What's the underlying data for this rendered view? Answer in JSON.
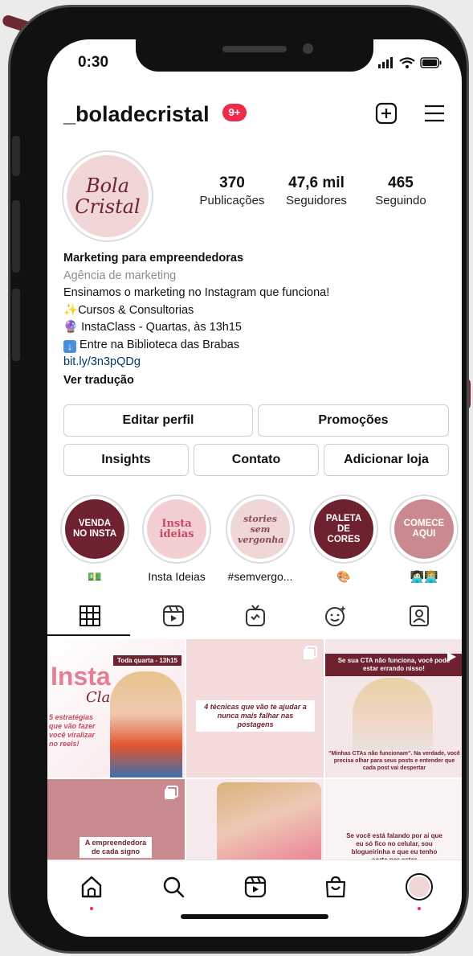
{
  "status": {
    "time": "0:30"
  },
  "profile": {
    "username": "_boladecristal",
    "notifications": "9+",
    "avatar_text_1": "Bola",
    "avatar_text_2": "Cristal",
    "stats": [
      {
        "value": "370",
        "label": "Publicações"
      },
      {
        "value": "47,6 mil",
        "label": "Seguidores"
      },
      {
        "value": "465",
        "label": "Seguindo"
      }
    ],
    "bio": {
      "name": "Marketing para empreendedoras",
      "category": "Agência de marketing",
      "line1": "Ensinamos o marketing no Instagram que funciona!",
      "line2": "Cursos & Consultorias",
      "line3": "InstaClass - Quartas, às 13h15",
      "line4": "Entre na Biblioteca das Brabas",
      "link": "bit.ly/3n3pQDg",
      "translate": "Ver tradução"
    }
  },
  "buttons": {
    "edit_profile": "Editar perfil",
    "promotions": "Promoções",
    "insights": "Insights",
    "contact": "Contato",
    "add_shop": "Adicionar loja"
  },
  "highlights": [
    {
      "cover_text": "VENDA NO INSTA",
      "label": "💵",
      "color": "#6e2230"
    },
    {
      "cover_text": "Insta ideias",
      "label": "Insta Ideias",
      "color": "#f3cfd3"
    },
    {
      "cover_text": "stories sem vergonha",
      "label": "#semvergo...",
      "color": "#efd7d7"
    },
    {
      "cover_text": "PALETA DE CORES",
      "label": "🎨",
      "color": "#6e2230"
    },
    {
      "cover_text": "COMECE AQUI",
      "label": "👩🏻‍💻👩🏼‍💻",
      "color": "#c98a8f"
    }
  ],
  "grid_posts": [
    {
      "top_badge": "Toda quarta - 13h15",
      "title": "Insta",
      "subtitle": "Class",
      "caption": "5 estratégias que vão fazer você viralizar no reels!"
    },
    {
      "caption": "4 técnicas que vão te ajudar a nunca mais falhar nas postagens"
    },
    {
      "top_text": "Se sua CTA não funciona, você pode estar errando nisso!",
      "caption": "\"Minhas CTAs não funcionam\". Na verdade, você precisa olhar para seus posts e entender que cada post vai despertar"
    },
    {
      "caption": "A empreendedora de cada signo"
    },
    {
      "caption": ""
    },
    {
      "caption": "Se você está falando por aí que eu só fico no celular, sou blogueirinha e que eu tenho sorte por estar"
    }
  ],
  "colors": {
    "accent": "#ef2b4a",
    "brand_wine": "#6e2230",
    "brand_pink": "#f0d6d6",
    "link": "#00376b"
  }
}
